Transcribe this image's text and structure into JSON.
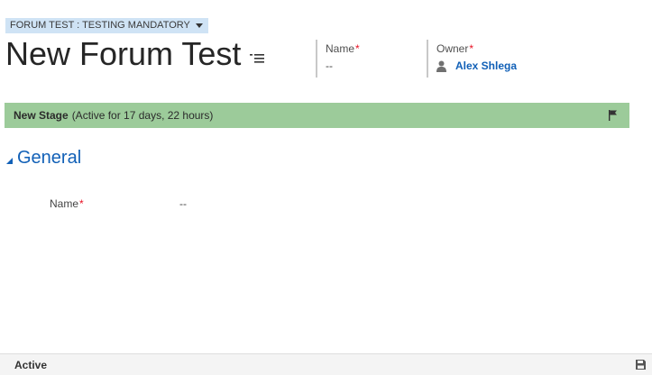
{
  "header": {
    "entity_selector": "FORUM TEST : TESTING MANDATORY",
    "record_title": "New Forum Test",
    "fields": {
      "name": {
        "label": "Name",
        "required_marker": "*",
        "value": "--"
      },
      "owner": {
        "label": "Owner",
        "required_marker": "*",
        "value": "Alex Shlega"
      }
    }
  },
  "stage": {
    "name": "New Stage",
    "duration": "(Active for 17 days, 22 hours)"
  },
  "section": {
    "title": "General",
    "fields": [
      {
        "label": "Name",
        "required_marker": "*",
        "value": "--"
      }
    ]
  },
  "footer": {
    "status": "Active"
  },
  "icons": {
    "entity_selector": "chevron-down-icon",
    "record_nav": "list-menu-icon",
    "owner": "person-icon",
    "stage": "flag-icon",
    "section": "collapse-caret-icon",
    "footer": "save-icon"
  },
  "colors": {
    "stage_bar": "#9ccb9a",
    "selector_bg": "#cfe3f5",
    "link": "#1160b7",
    "required": "#e81123"
  }
}
